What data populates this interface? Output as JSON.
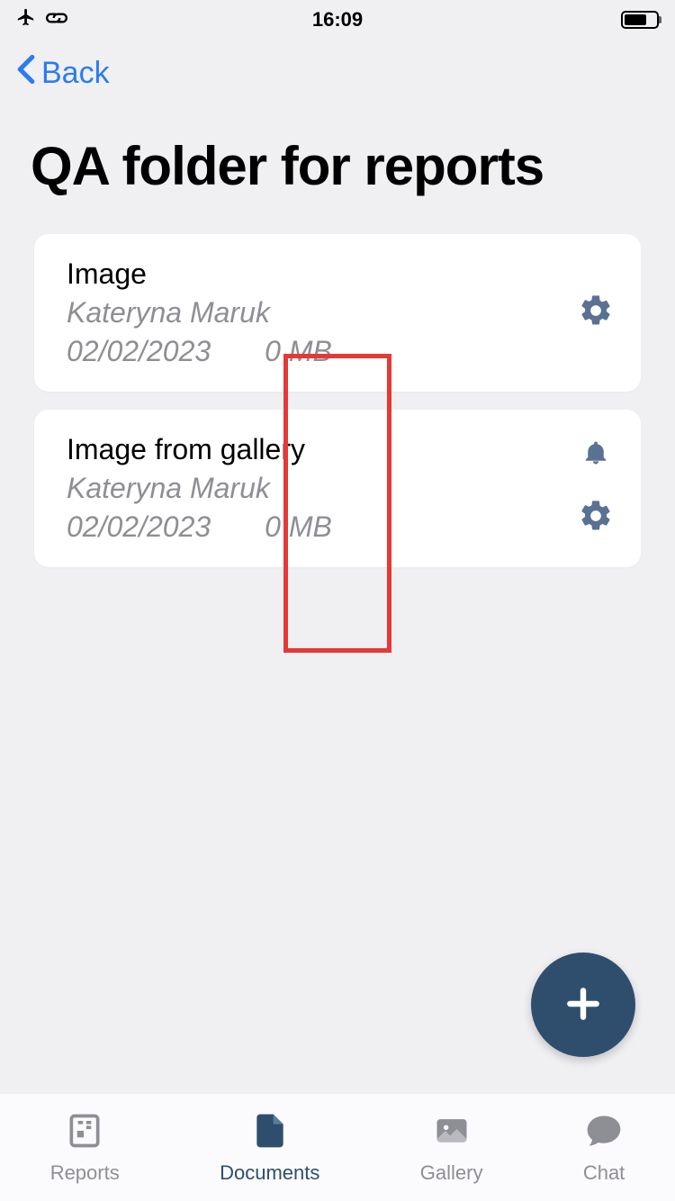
{
  "status": {
    "time": "16:09"
  },
  "nav": {
    "back_label": "Back"
  },
  "page": {
    "title": "QA  folder for reports"
  },
  "files": [
    {
      "title": "Image",
      "author": "Kateryna Maruk",
      "date": "02/02/2023",
      "size": "0 MB",
      "has_bell": false
    },
    {
      "title": "Image from gallery",
      "author": "Kateryna Maruk",
      "date": "02/02/2023",
      "size": "0 MB",
      "has_bell": true
    }
  ],
  "tabs": [
    {
      "id": "reports",
      "label": "Reports",
      "active": false
    },
    {
      "id": "documents",
      "label": "Documents",
      "active": true
    },
    {
      "id": "gallery",
      "label": "Gallery",
      "active": false
    },
    {
      "id": "chat",
      "label": "Chat",
      "active": false
    }
  ]
}
